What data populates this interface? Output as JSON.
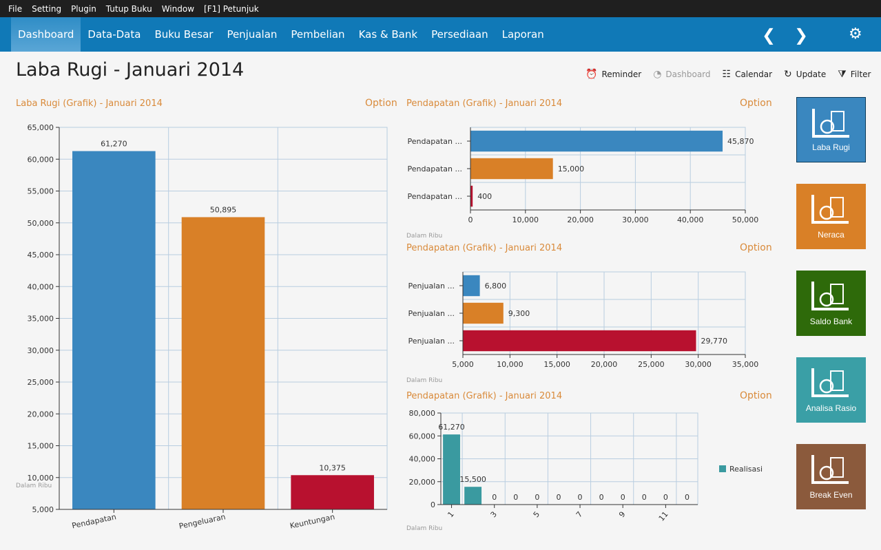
{
  "menubar": [
    "File",
    "Setting",
    "Plugin",
    "Tutup Buku",
    "Window",
    "[F1] Petunjuk"
  ],
  "nav": {
    "tabs": [
      "Dashboard",
      "Data-Data",
      "Buku Besar",
      "Penjualan",
      "Pembelian",
      "Kas & Bank",
      "Persediaan",
      "Laporan"
    ],
    "active": 0,
    "icons": [
      "chevron-left-icon",
      "chevron-right-icon",
      "gear-icon"
    ]
  },
  "page_title": "Laba Rugi - Januari 2014",
  "toolbar": [
    {
      "label": "Reminder",
      "icon": "alarm-clock-icon"
    },
    {
      "label": "Dashboard",
      "icon": "dashboard-icon",
      "disabled": true
    },
    {
      "label": "Calendar",
      "icon": "calendar-icon"
    },
    {
      "label": "Update",
      "icon": "refresh-icon"
    },
    {
      "label": "Filter",
      "icon": "filter-icon"
    }
  ],
  "option_label": "Option",
  "unit_label": "Dalam Ribu",
  "tiles": [
    {
      "label": "Laba Rugi",
      "color": "#3a87bf"
    },
    {
      "label": "Neraca",
      "color": "#d98027"
    },
    {
      "label": "Saldo Bank",
      "color": "#2e6a0a"
    },
    {
      "label": "Analisa Rasio",
      "color": "#3a9fa6"
    },
    {
      "label": "Break Even",
      "color": "#8b5a3c"
    }
  ],
  "chart_data": [
    {
      "type": "bar",
      "orientation": "vertical",
      "title": "Laba Rugi (Grafik) - Januari 2014",
      "categories": [
        "Pendapatan",
        "Pengeluaran",
        "Keuntungan"
      ],
      "values": [
        61270,
        50895,
        10375
      ],
      "colors": [
        "#3a87bf",
        "#d98027",
        "#b8112f"
      ],
      "ylim": [
        5000,
        65000
      ],
      "ystep": 5000,
      "grid": true,
      "data_labels": [
        "61,270",
        "50,895",
        "10,375"
      ]
    },
    {
      "type": "bar",
      "orientation": "horizontal",
      "title": "Pendapatan (Grafik) - Januari 2014",
      "categories": [
        "Pendapatan ...",
        "Pendapatan ...",
        "Pendapatan ..."
      ],
      "values": [
        45870,
        15000,
        400
      ],
      "colors": [
        "#3a87bf",
        "#d98027",
        "#b8112f"
      ],
      "xlim": [
        0,
        50000
      ],
      "xstep": 10000,
      "grid": true,
      "data_labels": [
        "45,870",
        "15,000",
        "400"
      ]
    },
    {
      "type": "bar",
      "orientation": "horizontal",
      "title": "Pendapatan (Grafik) - Januari 2014",
      "categories": [
        "Penjualan ...",
        "Penjualan ...",
        "Penjualan ..."
      ],
      "values": [
        6800,
        9300,
        29770
      ],
      "colors": [
        "#3a87bf",
        "#d98027",
        "#b8112f"
      ],
      "xlim": [
        5000,
        35000
      ],
      "xstep": 5000,
      "grid": true,
      "data_labels": [
        "6,800",
        "9,300",
        "29,770"
      ]
    },
    {
      "type": "bar",
      "orientation": "vertical",
      "title": "Pendapatan (Grafik) - Januari 2014",
      "categories": [
        "1",
        "2",
        "3",
        "4",
        "5",
        "6",
        "7",
        "8",
        "9",
        "10",
        "11",
        "12"
      ],
      "tick_labels_shown": [
        "1",
        "3",
        "5",
        "7",
        "9",
        "11"
      ],
      "series": [
        {
          "name": "Realisasi",
          "values": [
            61270,
            15500,
            0,
            0,
            0,
            0,
            0,
            0,
            0,
            0,
            0,
            0
          ],
          "color": "#3a9aa0"
        }
      ],
      "ylim": [
        0,
        80000
      ],
      "ystep": 20000,
      "grid": true,
      "legend": "right",
      "data_labels": [
        "61,270",
        "15,500",
        "0",
        "0",
        "0",
        "0",
        "0",
        "0",
        "0",
        "0",
        "0",
        "0"
      ]
    }
  ]
}
